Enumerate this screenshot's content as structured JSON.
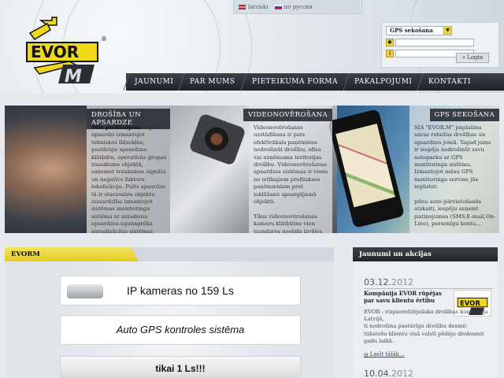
{
  "languages": [
    {
      "label": "latviski"
    },
    {
      "label": "по русски"
    }
  ],
  "logo": {
    "registered": "®"
  },
  "login": {
    "select_value": "GPS sekošana",
    "button": "» Login",
    "user_value": "",
    "pass_value": ""
  },
  "nav": {
    "items": [
      "JAUNUMI",
      "PAR MUMS",
      "PIETEIKUMA FORMA",
      "PAKALPOJUMI",
      "KONTAKTI"
    ]
  },
  "hero": {
    "panels": [
      {
        "heading": "DROŠĪBA UN APSARDZE",
        "lead": "Mēs piedāvājam:",
        "text": "objektu apsardzi izmantojot tehniskos līdzekļus, pastāvīgu apsardzes klātbūtu, operatīvās grupas izsaukums objektā, saņemot trauksmes signālu un negatīvo faktoru lokalizāciju. Pults apsardze tā ir stacionāra objektu aizsardzība izmantojot sistēmas monitoringa sistēma ar mūsdienu apsardzes-ugunsgrēka signalizācijas sistēmas piebetojumu un operatīvas grupas izbraukumu..."
      },
      {
        "heading": "VIDEONOVĒROŠANA",
        "lead": "",
        "text": "Videonovērošanas uzstādīšana ir pats efektīvākais paņēmiens nodrošināt drošību, ofisa vai uzņēmuma teritorijas drošību. Videonovērošanas apsardzes sistēmas ir viens no ietīkajiem profilakses paņēmieniem pret iekļūšanu apsargājamā objektā.\n\nTikai videonovērošanas kameru klātbūtne vien jaundaros nostida izvēles priekšā..."
      },
      {
        "heading": "GPS SEKOŠANA",
        "lead": "",
        "text": "SIA \"EVOR.M\" paplašina savas robežas drošības un apsardzes jomā. Tagad jums ir iespēja nodrošināt savu autoparku ar GPS monitoringa sistēmu. Izmantojot mūsu GPS monitoringa servisu jūs iegūstat:\n\npilnu auto pārvietošanās atskaiti, iespēju saņemt paziņojumus (SMS,E-mail,On-Line), personīgu kontu..."
      }
    ]
  },
  "main": {
    "tab": "EVORM",
    "banners": [
      "IP kameras no 159 Ls",
      "Auto GPS kontroles sistēma",
      "tikai 1 Ls!!!"
    ]
  },
  "news": {
    "heading": "Jaunumi un akcijas",
    "items": [
      {
        "day": "03.12.",
        "year": "2012",
        "title": "Kompānija EVOR rūpējas par savu klientu ērtību",
        "body": "EVOR - vispieredzējušaka drošības kompānija Latvijā,\nti nodrošina pastāvīgu drošību desmit tūkstošu klientu visā valstī pēdējo divdesmit gadu laikā.",
        "more": "Lasīt tālāk..."
      },
      {
        "day": "10.04.",
        "year": "2012"
      }
    ]
  },
  "colors": {
    "brand_yellow": "#f0d81a",
    "nav_dark": "#2b2f35",
    "panel_head": "#2c3038"
  }
}
